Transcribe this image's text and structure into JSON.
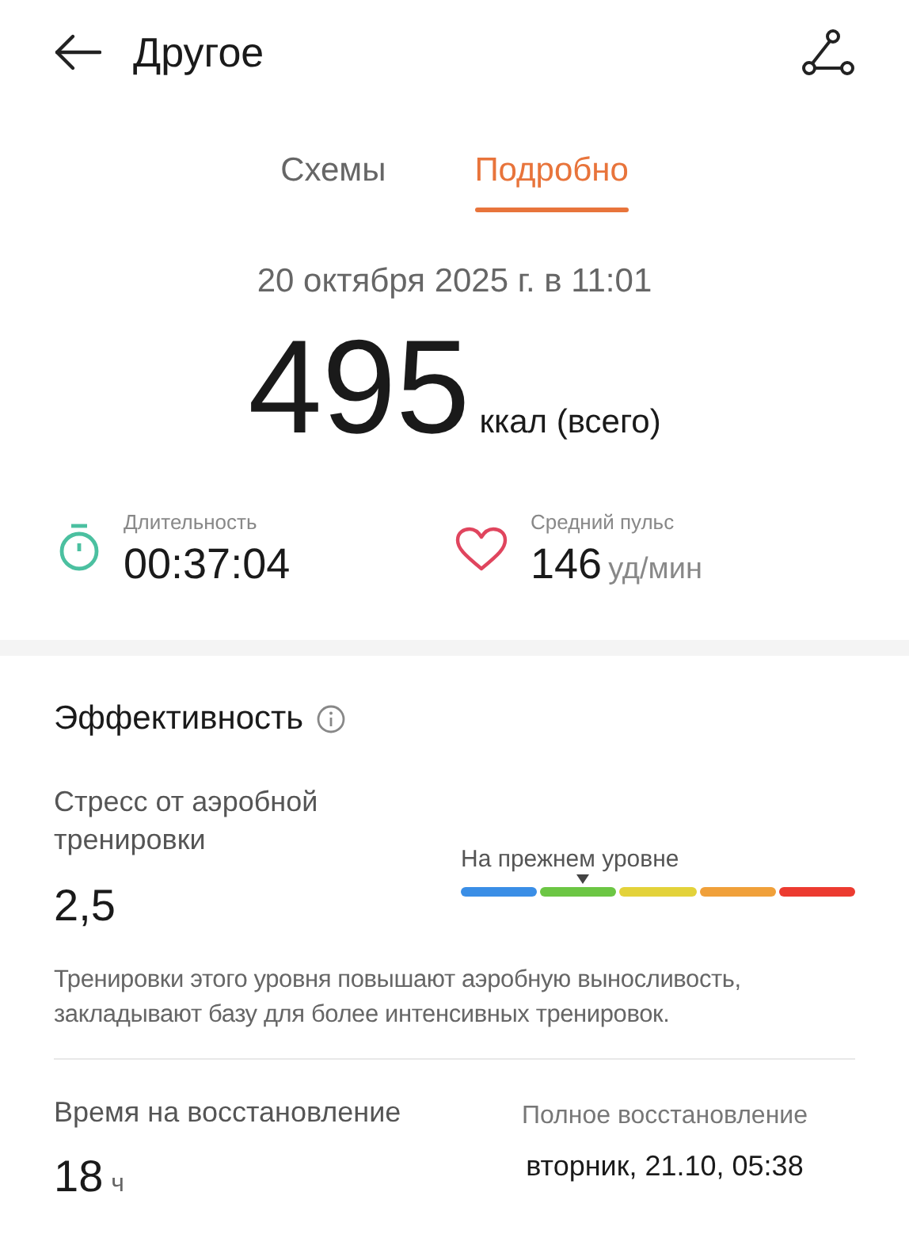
{
  "header": {
    "title": "Другое"
  },
  "tabs": [
    {
      "label": "Схемы",
      "selected": false
    },
    {
      "label": "Подробно",
      "selected": true
    }
  ],
  "date": "20 октября 2025 г. в 11:01",
  "calories": {
    "value": "495",
    "unit": "ккал (всего)"
  },
  "stats": [
    {
      "kind": "duration",
      "label": "Длительность",
      "value": "00:37:04"
    },
    {
      "kind": "pulse",
      "label": "Средний пульс",
      "value": "146",
      "unit": "уд/мин"
    }
  ],
  "efficiency": {
    "title": "Эффективность",
    "stress_label": "Стресс от аэробной тренировки",
    "stress_value": "2,5",
    "scale_label": "На прежнем уровне",
    "level": 0.31,
    "description": "Тренировки этого уровня повышают аэробную выносливость, закладывают базу для более интенсивных тренировок."
  },
  "recovery": {
    "label": "Время на восстановление",
    "value": "18",
    "unit": "ч",
    "full_label": "Полное восстановление",
    "full_value": "вторник, 21.10, 05:38"
  }
}
